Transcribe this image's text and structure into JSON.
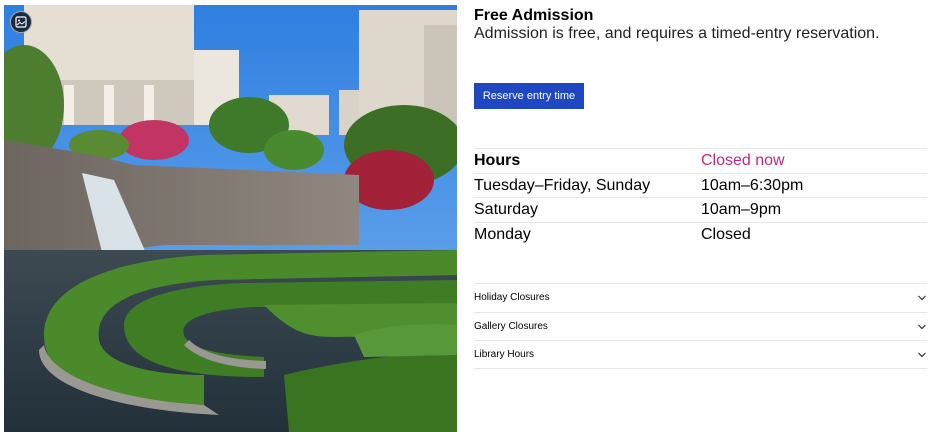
{
  "admission": {
    "title": "Free Admission",
    "description": "Admission is free, and requires a timed-entry reservation.",
    "reserve_label": "Reserve entry time"
  },
  "hours": {
    "heading": "Hours",
    "status": "Closed now",
    "status_color": "#c0267f",
    "rows": [
      {
        "day": "Tuesday–Friday, Sunday",
        "time": "10am–6:30pm"
      },
      {
        "day": "Saturday",
        "time": "10am–9pm"
      },
      {
        "day": "Monday",
        "time": "Closed"
      }
    ]
  },
  "accordion": [
    {
      "label": "Holiday Closures",
      "icon": "chevron-down-icon"
    },
    {
      "label": "Gallery Closures",
      "icon": "chevron-down-icon"
    },
    {
      "label": "Library Hours",
      "icon": "chevron-down-icon"
    }
  ],
  "photo": {
    "badge_icon": "image-caption-icon"
  },
  "colors": {
    "button": "#1f47c2",
    "divider": "#e6e6e6"
  }
}
